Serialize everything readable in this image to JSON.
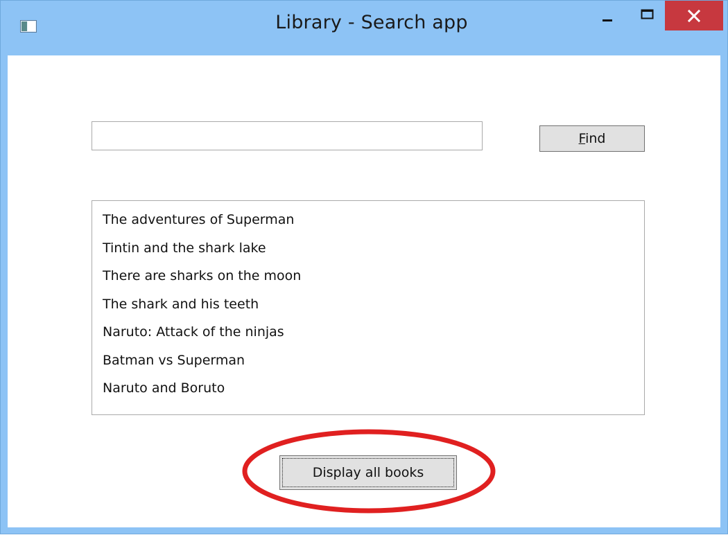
{
  "window": {
    "title": "Library - Search app",
    "controls": [
      "minimize-icon",
      "maximize-icon",
      "close-icon"
    ]
  },
  "search": {
    "value": "",
    "placeholder": ""
  },
  "find_button": {
    "access_key": "F",
    "rest": "ind"
  },
  "books": [
    "The adventures of Superman",
    "Tintin and the shark lake",
    "There are sharks on the moon",
    "The shark and his teeth",
    "Naruto: Attack of the ninjas",
    "Batman vs Superman",
    "Naruto and Boruto"
  ],
  "display_button": {
    "label": "Display all books"
  },
  "colors": {
    "titlebar": "#8dc3f5",
    "close": "#c7383f",
    "annotation": "#e02020"
  }
}
